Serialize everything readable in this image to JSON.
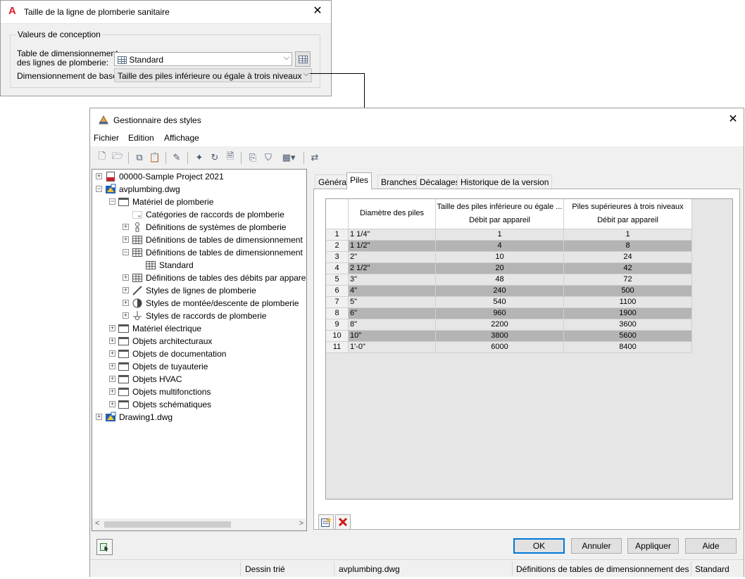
{
  "sizing_dialog": {
    "title": "Taille de la ligne de plomberie sanitaire",
    "group_label": "Valeurs de conception",
    "table_label_line1": "Table de dimensionnement",
    "table_label_line2": "des lignes de plomberie:",
    "table_value": "Standard",
    "basis_label": "Dimensionnement de base:",
    "basis_value": "Taille des piles inférieure ou égale à trois niveaux"
  },
  "style_manager": {
    "title": "Gestionnaire des styles",
    "menus": [
      "Fichier",
      "Edition",
      "Affichage"
    ],
    "tree": [
      {
        "label": "00000-Sample Project 2021",
        "level": 0,
        "expander": "+",
        "icon": "project-icon"
      },
      {
        "label": "avplumbing.dwg",
        "level": 0,
        "expander": "-",
        "icon": "drawing-icon"
      },
      {
        "label": "Matériel de plomberie",
        "level": 1,
        "expander": "-",
        "icon": "folder-icon"
      },
      {
        "label": "Catégories de raccords de plomberie",
        "level": 2,
        "expander": "",
        "icon": "category-icon"
      },
      {
        "label": "Définitions de systèmes de plomberie",
        "level": 2,
        "expander": "+",
        "icon": "system-icon"
      },
      {
        "label": "Définitions de tables de dimensionnement",
        "level": 2,
        "expander": "+",
        "icon": "table-icon"
      },
      {
        "label": "Définitions de tables de dimensionnement",
        "level": 2,
        "expander": "-",
        "icon": "table-icon"
      },
      {
        "label": "Standard",
        "level": 3,
        "expander": "",
        "icon": "table-icon"
      },
      {
        "label": "Définitions de tables des débits par appare",
        "level": 2,
        "expander": "+",
        "icon": "table-icon"
      },
      {
        "label": "Styles de lignes de plomberie",
        "level": 2,
        "expander": "+",
        "icon": "line-style-icon"
      },
      {
        "label": "Styles de montée/descente de plomberie",
        "level": 2,
        "expander": "+",
        "icon": "rise-drop-icon"
      },
      {
        "label": "Styles de raccords de plomberie",
        "level": 2,
        "expander": "+",
        "icon": "fitting-icon"
      },
      {
        "label": "Matériel électrique",
        "level": 1,
        "expander": "+",
        "icon": "folder-icon"
      },
      {
        "label": "Objets architecturaux",
        "level": 1,
        "expander": "+",
        "icon": "folder-icon"
      },
      {
        "label": "Objets de documentation",
        "level": 1,
        "expander": "+",
        "icon": "folder-icon"
      },
      {
        "label": "Objets de tuyauterie",
        "level": 1,
        "expander": "+",
        "icon": "folder-icon"
      },
      {
        "label": "Objets HVAC",
        "level": 1,
        "expander": "+",
        "icon": "folder-icon"
      },
      {
        "label": "Objets multifonctions",
        "level": 1,
        "expander": "+",
        "icon": "folder-icon"
      },
      {
        "label": "Objets schématiques",
        "level": 1,
        "expander": "+",
        "icon": "folder-icon"
      },
      {
        "label": "Drawing1.dwg",
        "level": 0,
        "expander": "+",
        "icon": "drawing-icon"
      }
    ],
    "tabs": [
      "Général",
      "Piles",
      "Branches",
      "Décalages",
      "Historique de la version"
    ],
    "active_tab": "Piles",
    "table": {
      "col1_header": "Diamètre des piles",
      "col2_header_top": "Taille des piles inférieure ou égale ...",
      "col2_header_sub": "Débit par appareil",
      "col3_header_top": "Piles supérieures à trois niveaux",
      "col3_header_sub": "Débit par appareil",
      "rows": [
        {
          "n": "1",
          "d": "1 1/4\"",
          "a": "1",
          "b": "1"
        },
        {
          "n": "2",
          "d": "1 1/2\"",
          "a": "4",
          "b": "8"
        },
        {
          "n": "3",
          "d": "2\"",
          "a": "10",
          "b": "24"
        },
        {
          "n": "4",
          "d": "2 1/2\"",
          "a": "20",
          "b": "42"
        },
        {
          "n": "5",
          "d": "3\"",
          "a": "48",
          "b": "72"
        },
        {
          "n": "6",
          "d": "4\"",
          "a": "240",
          "b": "500"
        },
        {
          "n": "7",
          "d": "5\"",
          "a": "540",
          "b": "1100"
        },
        {
          "n": "8",
          "d": "6\"",
          "a": "960",
          "b": "1900"
        },
        {
          "n": "9",
          "d": "8\"",
          "a": "2200",
          "b": "3600"
        },
        {
          "n": "10",
          "d": "10\"",
          "a": "3800",
          "b": "5600"
        },
        {
          "n": "11",
          "d": "1'-0\"",
          "a": "6000",
          "b": "8400"
        }
      ]
    },
    "buttons": {
      "ok": "OK",
      "cancel": "Annuler",
      "apply": "Appliquer",
      "help": "Aide"
    },
    "status": {
      "sort": "Dessin trié",
      "drawing": "avplumbing.dwg",
      "definition": "Définitions de tables de dimensionnement des c",
      "style": "Standard"
    }
  },
  "colors": {
    "accent": "#0078d7",
    "alt_row": "#b4b4b4",
    "delete_red": "#d01919"
  }
}
